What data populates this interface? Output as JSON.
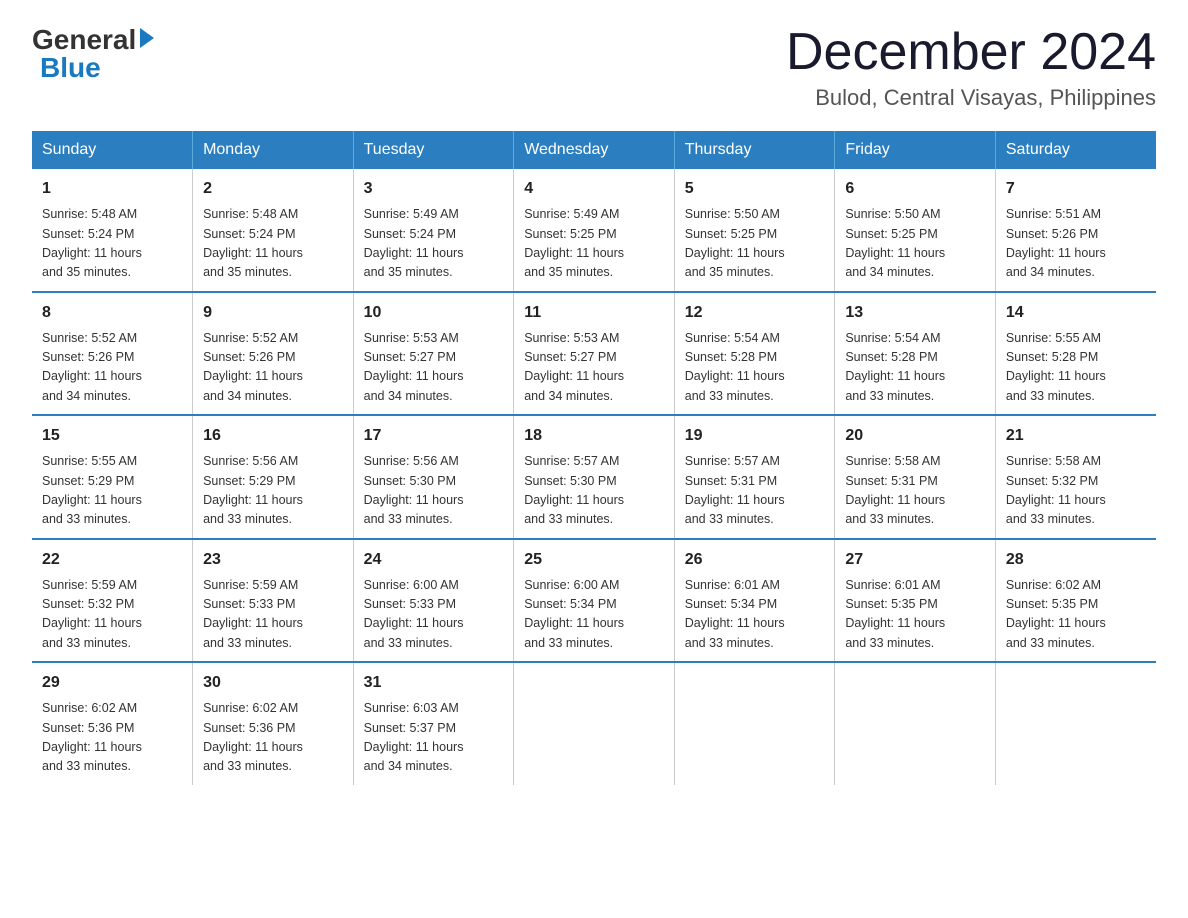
{
  "logo": {
    "general": "General",
    "blue": "Blue"
  },
  "header": {
    "month": "December 2024",
    "location": "Bulod, Central Visayas, Philippines"
  },
  "weekdays": [
    "Sunday",
    "Monday",
    "Tuesday",
    "Wednesday",
    "Thursday",
    "Friday",
    "Saturday"
  ],
  "weeks": [
    [
      {
        "day": "1",
        "sunrise": "5:48 AM",
        "sunset": "5:24 PM",
        "daylight": "11 hours and 35 minutes."
      },
      {
        "day": "2",
        "sunrise": "5:48 AM",
        "sunset": "5:24 PM",
        "daylight": "11 hours and 35 minutes."
      },
      {
        "day": "3",
        "sunrise": "5:49 AM",
        "sunset": "5:24 PM",
        "daylight": "11 hours and 35 minutes."
      },
      {
        "day": "4",
        "sunrise": "5:49 AM",
        "sunset": "5:25 PM",
        "daylight": "11 hours and 35 minutes."
      },
      {
        "day": "5",
        "sunrise": "5:50 AM",
        "sunset": "5:25 PM",
        "daylight": "11 hours and 35 minutes."
      },
      {
        "day": "6",
        "sunrise": "5:50 AM",
        "sunset": "5:25 PM",
        "daylight": "11 hours and 34 minutes."
      },
      {
        "day": "7",
        "sunrise": "5:51 AM",
        "sunset": "5:26 PM",
        "daylight": "11 hours and 34 minutes."
      }
    ],
    [
      {
        "day": "8",
        "sunrise": "5:52 AM",
        "sunset": "5:26 PM",
        "daylight": "11 hours and 34 minutes."
      },
      {
        "day": "9",
        "sunrise": "5:52 AM",
        "sunset": "5:26 PM",
        "daylight": "11 hours and 34 minutes."
      },
      {
        "day": "10",
        "sunrise": "5:53 AM",
        "sunset": "5:27 PM",
        "daylight": "11 hours and 34 minutes."
      },
      {
        "day": "11",
        "sunrise": "5:53 AM",
        "sunset": "5:27 PM",
        "daylight": "11 hours and 34 minutes."
      },
      {
        "day": "12",
        "sunrise": "5:54 AM",
        "sunset": "5:28 PM",
        "daylight": "11 hours and 33 minutes."
      },
      {
        "day": "13",
        "sunrise": "5:54 AM",
        "sunset": "5:28 PM",
        "daylight": "11 hours and 33 minutes."
      },
      {
        "day": "14",
        "sunrise": "5:55 AM",
        "sunset": "5:28 PM",
        "daylight": "11 hours and 33 minutes."
      }
    ],
    [
      {
        "day": "15",
        "sunrise": "5:55 AM",
        "sunset": "5:29 PM",
        "daylight": "11 hours and 33 minutes."
      },
      {
        "day": "16",
        "sunrise": "5:56 AM",
        "sunset": "5:29 PM",
        "daylight": "11 hours and 33 minutes."
      },
      {
        "day": "17",
        "sunrise": "5:56 AM",
        "sunset": "5:30 PM",
        "daylight": "11 hours and 33 minutes."
      },
      {
        "day": "18",
        "sunrise": "5:57 AM",
        "sunset": "5:30 PM",
        "daylight": "11 hours and 33 minutes."
      },
      {
        "day": "19",
        "sunrise": "5:57 AM",
        "sunset": "5:31 PM",
        "daylight": "11 hours and 33 minutes."
      },
      {
        "day": "20",
        "sunrise": "5:58 AM",
        "sunset": "5:31 PM",
        "daylight": "11 hours and 33 minutes."
      },
      {
        "day": "21",
        "sunrise": "5:58 AM",
        "sunset": "5:32 PM",
        "daylight": "11 hours and 33 minutes."
      }
    ],
    [
      {
        "day": "22",
        "sunrise": "5:59 AM",
        "sunset": "5:32 PM",
        "daylight": "11 hours and 33 minutes."
      },
      {
        "day": "23",
        "sunrise": "5:59 AM",
        "sunset": "5:33 PM",
        "daylight": "11 hours and 33 minutes."
      },
      {
        "day": "24",
        "sunrise": "6:00 AM",
        "sunset": "5:33 PM",
        "daylight": "11 hours and 33 minutes."
      },
      {
        "day": "25",
        "sunrise": "6:00 AM",
        "sunset": "5:34 PM",
        "daylight": "11 hours and 33 minutes."
      },
      {
        "day": "26",
        "sunrise": "6:01 AM",
        "sunset": "5:34 PM",
        "daylight": "11 hours and 33 minutes."
      },
      {
        "day": "27",
        "sunrise": "6:01 AM",
        "sunset": "5:35 PM",
        "daylight": "11 hours and 33 minutes."
      },
      {
        "day": "28",
        "sunrise": "6:02 AM",
        "sunset": "5:35 PM",
        "daylight": "11 hours and 33 minutes."
      }
    ],
    [
      {
        "day": "29",
        "sunrise": "6:02 AM",
        "sunset": "5:36 PM",
        "daylight": "11 hours and 33 minutes."
      },
      {
        "day": "30",
        "sunrise": "6:02 AM",
        "sunset": "5:36 PM",
        "daylight": "11 hours and 33 minutes."
      },
      {
        "day": "31",
        "sunrise": "6:03 AM",
        "sunset": "5:37 PM",
        "daylight": "11 hours and 34 minutes."
      },
      null,
      null,
      null,
      null
    ]
  ],
  "labels": {
    "sunrise": "Sunrise:",
    "sunset": "Sunset:",
    "daylight": "Daylight:"
  }
}
